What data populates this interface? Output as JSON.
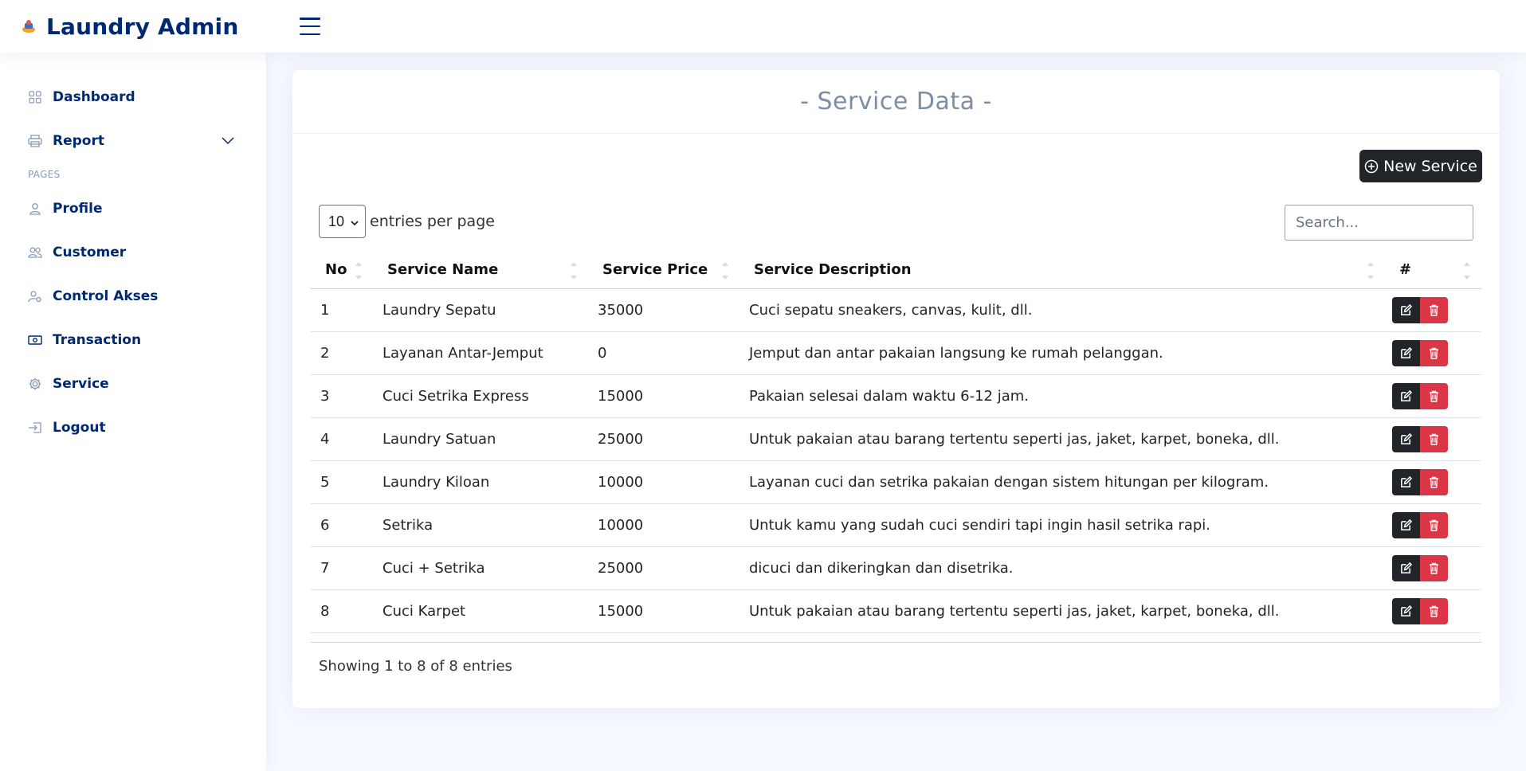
{
  "app": {
    "title": "Laundry Admin"
  },
  "sidebar": {
    "items": [
      {
        "label": "Dashboard",
        "icon": "grid-icon"
      },
      {
        "label": "Report",
        "icon": "printer-icon"
      }
    ],
    "heading": "PAGES",
    "pages": [
      {
        "label": "Profile",
        "icon": "person-icon"
      },
      {
        "label": "Customer",
        "icon": "people-icon"
      },
      {
        "label": "Control Akses",
        "icon": "person-gear-icon"
      },
      {
        "label": "Transaction",
        "icon": "cash-icon"
      },
      {
        "label": "Service",
        "icon": "gear-icon"
      },
      {
        "label": "Logout",
        "icon": "box-arrow-in-icon"
      }
    ]
  },
  "main": {
    "title": "- Service Data -",
    "new_button": "New Service",
    "per_page": {
      "value": "10",
      "label": "entries per page"
    },
    "search": {
      "placeholder": "Search...",
      "value": ""
    },
    "table": {
      "columns": [
        "No",
        "Service Name",
        "Service Price",
        "Service Description",
        "#"
      ],
      "rows": [
        [
          "1",
          "Laundry Sepatu",
          "35000",
          "Cuci sepatu sneakers, canvas, kulit, dll."
        ],
        [
          "2",
          "Layanan Antar-Jemput",
          "0",
          "Jemput dan antar pakaian langsung ke rumah pelanggan."
        ],
        [
          "3",
          "Cuci Setrika Express",
          "15000",
          "Pakaian selesai dalam waktu 6-12 jam."
        ],
        [
          "4",
          "Laundry Satuan",
          "25000",
          "Untuk pakaian atau barang tertentu seperti jas, jaket, karpet, boneka, dll."
        ],
        [
          "5",
          "Laundry Kiloan",
          "10000",
          "Layanan cuci dan setrika pakaian dengan sistem hitungan per kilogram."
        ],
        [
          "6",
          "Setrika",
          "10000",
          "Untuk kamu yang sudah cuci sendiri tapi ingin hasil setrika rapi."
        ],
        [
          "7",
          "Cuci + Setrika",
          "25000",
          "dicuci dan dikeringkan dan disetrika."
        ],
        [
          "8",
          "Cuci Karpet",
          "15000",
          "Untuk pakaian atau barang tertentu seperti jas, jaket, karpet, boneka, dll."
        ]
      ]
    },
    "info": "Showing 1 to 8 of 8 entries"
  },
  "colors": {
    "brand": "#012970",
    "edit": "#212529",
    "delete": "#dc3545",
    "background": "#f6f9ff"
  }
}
